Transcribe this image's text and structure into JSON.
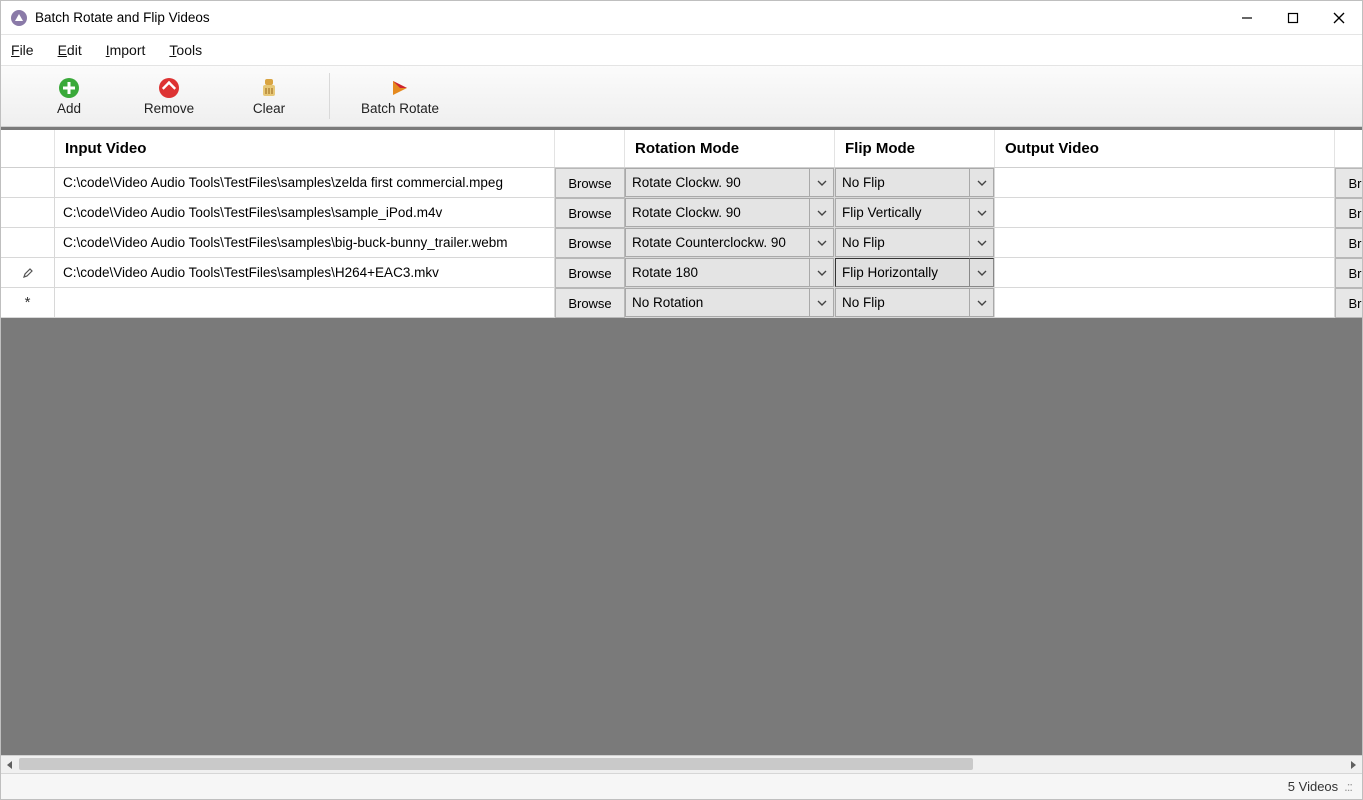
{
  "window": {
    "title": "Batch Rotate and Flip Videos"
  },
  "menus": {
    "file": "File",
    "edit": "Edit",
    "import": "Import",
    "tools": "Tools"
  },
  "toolbar": {
    "add": "Add",
    "remove": "Remove",
    "clear": "Clear",
    "batch_rotate": "Batch Rotate"
  },
  "columns": {
    "input": "Input Video",
    "rotation": "Rotation Mode",
    "flip": "Flip Mode",
    "output": "Output Video"
  },
  "browse_label": "Browse",
  "browse_label_short": "Br",
  "rows": [
    {
      "indicator": "",
      "input": "C:\\code\\Video Audio Tools\\TestFiles\\samples\\zelda first commercial.mpeg",
      "rotation": "Rotate Clockw. 90",
      "flip": "No Flip",
      "output": "",
      "flip_sunken": false
    },
    {
      "indicator": "",
      "input": "C:\\code\\Video Audio Tools\\TestFiles\\samples\\sample_iPod.m4v",
      "rotation": "Rotate Clockw. 90",
      "flip": "Flip Vertically",
      "output": "",
      "flip_sunken": false
    },
    {
      "indicator": "",
      "input": "C:\\code\\Video Audio Tools\\TestFiles\\samples\\big-buck-bunny_trailer.webm",
      "rotation": "Rotate Counterclockw. 90",
      "flip": "No Flip",
      "output": "",
      "flip_sunken": false
    },
    {
      "indicator": "edit",
      "input": "C:\\code\\Video Audio Tools\\TestFiles\\samples\\H264+EAC3.mkv",
      "rotation": "Rotate 180",
      "flip": "Flip Horizontally",
      "output": "",
      "flip_sunken": true
    },
    {
      "indicator": "new",
      "input": "",
      "rotation": "No Rotation",
      "flip": "No Flip",
      "output": "",
      "flip_sunken": false
    }
  ],
  "status": {
    "count_text": "5 Videos"
  }
}
